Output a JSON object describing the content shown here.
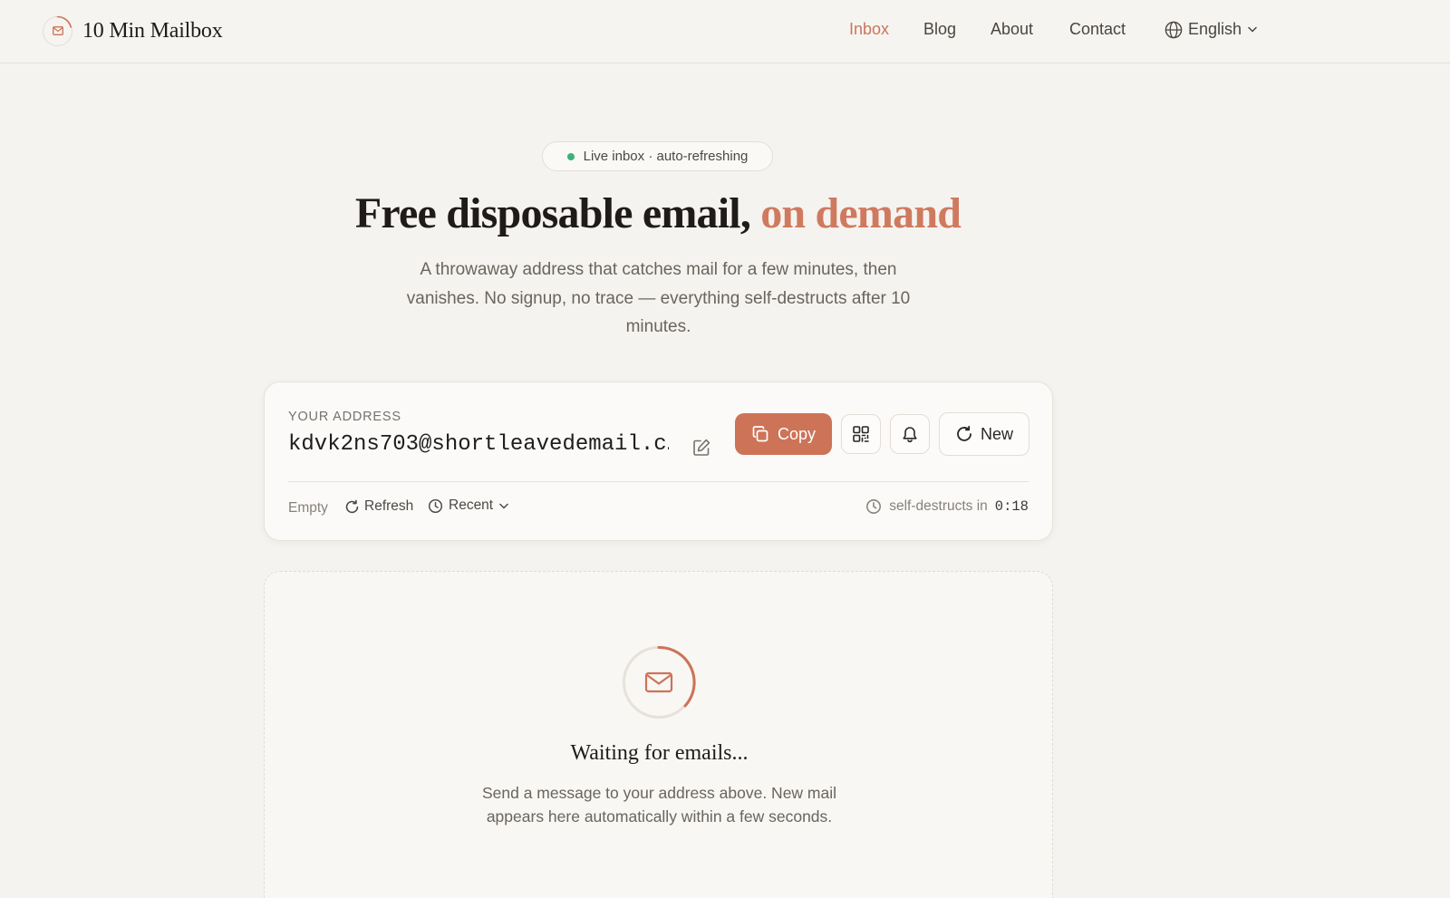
{
  "brand": {
    "name": "10 Min Mailbox"
  },
  "nav": {
    "links": [
      "Inbox",
      "Blog",
      "About",
      "Contact"
    ],
    "active": "Inbox",
    "language": "English"
  },
  "hero": {
    "badge": "Live inbox · auto-refreshing",
    "title_main": "Free disposable email, ",
    "title_accent": "on demand",
    "subtitle": "A throwaway address that catches mail for a few minutes, then vanishes. No signup, no trace — everything self-destructs after 10 minutes."
  },
  "address_card": {
    "label": "YOUR ADDRESS",
    "address": "kdvk2ns703@shortleavedemail.c…",
    "copy_label": "Copy",
    "new_label": "New",
    "status": "Empty",
    "refresh_label": "Refresh",
    "sort_label": "Recent",
    "timer_label": "self-destructs in",
    "countdown": "0:18"
  },
  "empty_state": {
    "title": "Waiting for emails...",
    "text": "Send a message to your address above. New mail appears here automatically within a few seconds."
  },
  "colors": {
    "accent": "#cd7358",
    "live_dot": "#3cb27a",
    "background": "#f5f3ef"
  },
  "icons": {
    "brand": "mail-icon",
    "language": "globe-icon",
    "edit": "edit-icon",
    "copy": "copy-icon",
    "qr": "qr-code-icon",
    "notify": "bell-icon",
    "new": "refresh-icon",
    "refresh": "refresh-icon",
    "sort": "clock-icon",
    "timer": "clock-icon",
    "empty": "envelope-icon"
  }
}
